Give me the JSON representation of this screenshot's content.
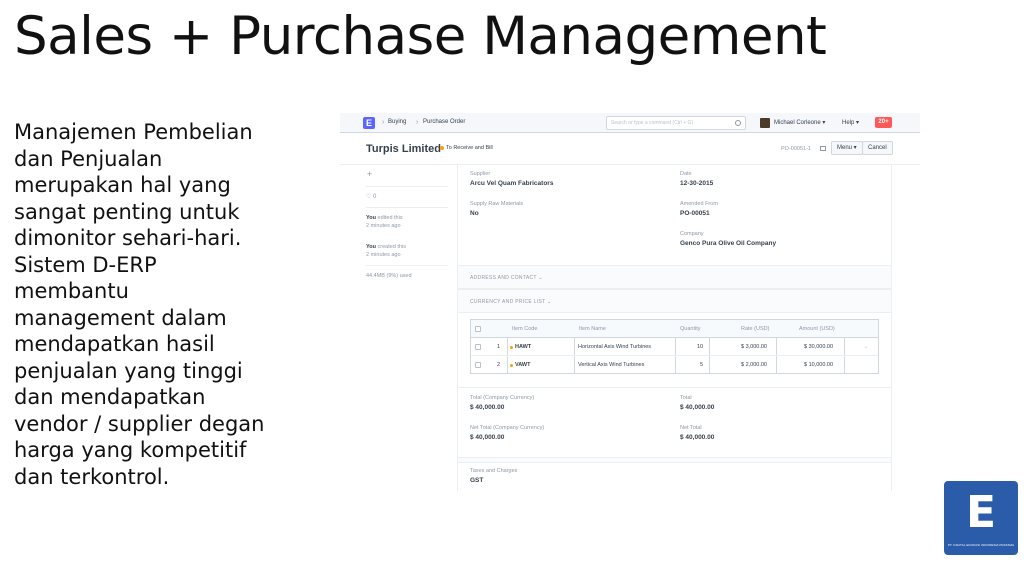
{
  "slide": {
    "title": "Sales + Purchase Management",
    "body_lines": [
      "Manajemen Pembelian",
      "dan Penjualan",
      "merupakan hal yang",
      "sangat penting untuk",
      "dimonitor sehari-hari.",
      "Sistem D-ERP",
      "membantu",
      "management dalam",
      "mendapatkan hasil",
      "penjualan yang tinggi",
      "dan mendapatkan",
      "vendor / supplier degan",
      "harga yang kompetitif",
      "dan terkontrol."
    ]
  },
  "app": {
    "navbar": {
      "logo": "E",
      "breadcrumbs": [
        "Buying",
        "Purchase Order"
      ],
      "search_placeholder": "Search or type a command (Ctrl + G)",
      "user": "Michael Corleone ▾",
      "help": "Help ▾",
      "notifications": "20+"
    },
    "header": {
      "title": "Turpis Limited",
      "status": "To Receive and Bill",
      "status_color": "#ffa00a",
      "doc_name": "PO-00051-1",
      "menu_label": "Menu ▾",
      "cancel_label": "Cancel"
    },
    "sidebar": {
      "add": "+",
      "likes": "♡ 0",
      "edited_by": "You",
      "edited_text": " edited this",
      "edited_time": "2 minutes ago",
      "created_by": "You",
      "created_text": " created this",
      "created_time": "2 minutes ago",
      "storage": "44.4MB (9%) used"
    },
    "form": {
      "supplier_label": "Supplier",
      "supplier_value": "Arcu Vel Quam Fabricators",
      "date_label": "Date",
      "date_value": "12-30-2015",
      "supply_raw_label": "Supply Raw Materials",
      "supply_raw_value": "No",
      "amended_label": "Amended From",
      "amended_value": "PO-00051",
      "company_label": "Company",
      "company_value": "Genco Pura Olive Oil Company",
      "section_address": "ADDRESS AND CONTACT ⌄",
      "section_currency": "CURRENCY AND PRICE LIST ⌄",
      "items": {
        "headers": [
          "Item Code",
          "Item Name",
          "Quantity",
          "Rate (USD)",
          "Amount (USD)"
        ],
        "rows": [
          {
            "idx": "1",
            "code": "HAWT",
            "name": "Horizontal Axis Wind Turbines",
            "qty": "10",
            "rate": "$ 3,000.00",
            "amount": "$ 30,000.00"
          },
          {
            "idx": "2",
            "code": "VAWT",
            "name": "Vertical Axis Wind Turbines",
            "qty": "5",
            "rate": "$ 2,000.00",
            "amount": "$ 10,000.00"
          }
        ]
      },
      "total_company_label": "Total (Company Currency)",
      "total_company_value": "$ 40,000.00",
      "total_label": "Total",
      "total_value": "$ 40,000.00",
      "net_company_label": "Net Total (Company Currency)",
      "net_company_value": "$ 40,000.00",
      "net_label": "Net Total",
      "net_value": "$ 40,000.00",
      "taxes_label": "Taxes and Charges",
      "taxes_value": "GST"
    }
  },
  "brand": {
    "logo_letter": "E",
    "logo_caption": "PT. DIGITAL EDUKASI INDONESIA PRATAMA",
    "logo_color": "#2a5caa"
  }
}
